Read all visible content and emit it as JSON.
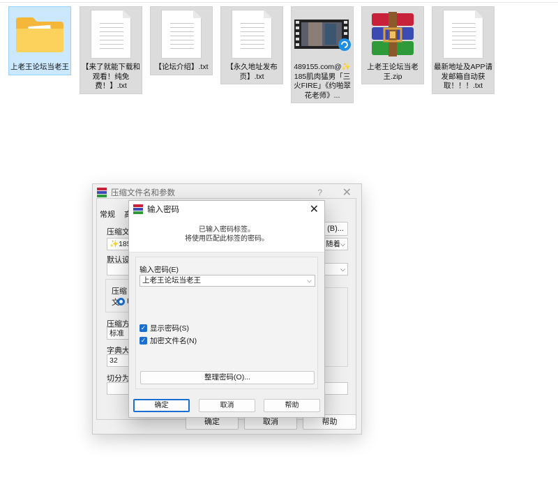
{
  "desktop": {
    "files": [
      {
        "label": "上老王论坛当老王",
        "icon": "folder-icon",
        "selected": true
      },
      {
        "label": "【来了就能下载和观看！纯免费！】.txt",
        "icon": "text-file-icon"
      },
      {
        "label": "【论坛介绍】.txt",
        "icon": "text-file-icon"
      },
      {
        "label": "【永久地址发布页】.txt",
        "icon": "text-file-icon"
      },
      {
        "label": "489155.com@✨185肌肉猛男「三火FIRE」《约啪翠花老师》...",
        "icon": "video-file-icon"
      },
      {
        "label": "上老王论坛当老王.zip",
        "icon": "winrar-archive-icon"
      },
      {
        "label": "最新地址及APP请发邮箱自动获取！！！.txt",
        "icon": "text-file-icon"
      }
    ]
  },
  "archive_dialog": {
    "title": "压缩文件名和参数",
    "help_glyph": "?",
    "tab_general": "常规",
    "tab_partial": "高",
    "archive_name_label": "压缩文件",
    "archive_name_value": "✨185",
    "browse_button": "(B)...",
    "update_mode_value": "随着",
    "default_profile_label": "默认设置",
    "format_label": "压缩文",
    "format_radio": "R",
    "method_label": "压缩方",
    "method_value": "标准",
    "dict_label": "字典大小",
    "dict_value": "32",
    "split_label": "切分为分",
    "ok_button": "确定",
    "cancel_button": "取消",
    "help_button": "帮助"
  },
  "password_dialog": {
    "title": "输入密码",
    "message_line1": "已输入密码标签。",
    "message_line2": "将使用匹配此标签的密码。",
    "password_label": "输入密码(E)",
    "password_value": "上老王论坛当老王",
    "show_password_label": "显示密码(S)",
    "show_password_checked": true,
    "encrypt_names_label": "加密文件名(N)",
    "encrypt_names_checked": true,
    "organize_button": "整理密码(O)...",
    "ok_button": "确定",
    "cancel_button": "取消",
    "help_button": "帮助"
  }
}
